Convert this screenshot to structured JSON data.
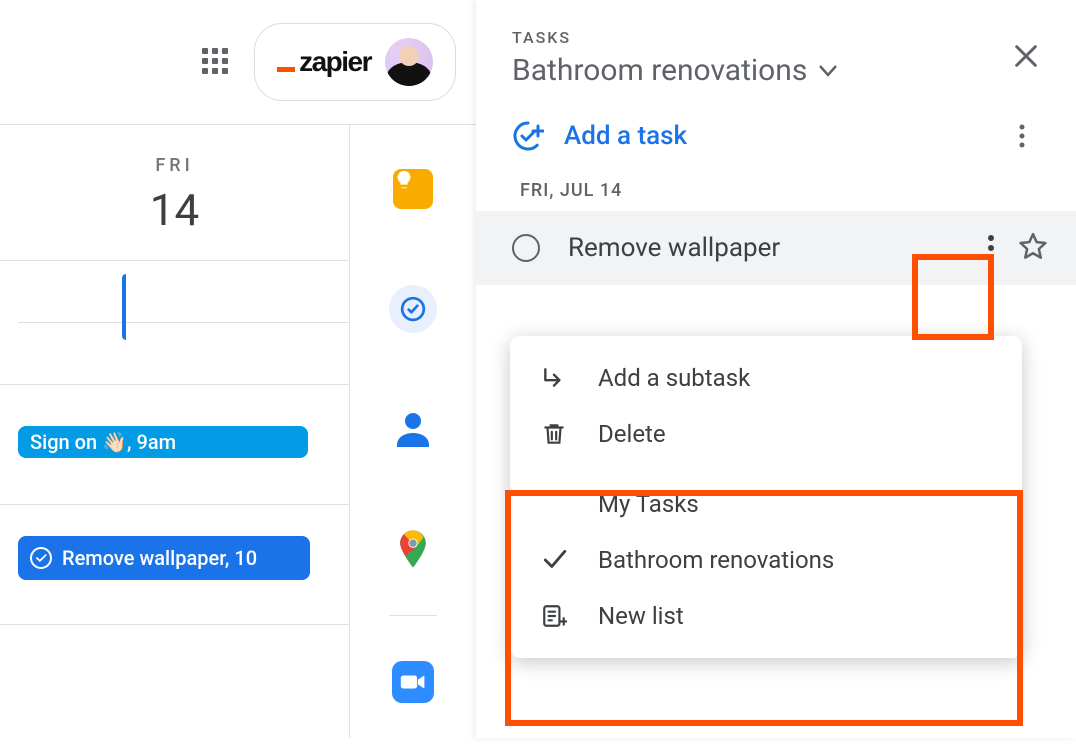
{
  "topbar": {
    "brand": "zapier"
  },
  "calendar": {
    "day_label": "FRI",
    "day_num": "14",
    "events": [
      {
        "title": "Sign on 👋🏻, 9am"
      },
      {
        "title": "Remove wallpaper, 10"
      }
    ]
  },
  "panel": {
    "kicker": "TASKS",
    "selected_list": "Bathroom renovations",
    "add_task_label": "Add a task",
    "date_header": "FRI, JUL 14",
    "task": {
      "title": "Remove wallpaper"
    }
  },
  "menu": {
    "add_subtask": "Add a subtask",
    "delete": "Delete",
    "list_my_tasks": "My Tasks",
    "list_selected": "Bathroom renovations",
    "new_list": "New list"
  }
}
